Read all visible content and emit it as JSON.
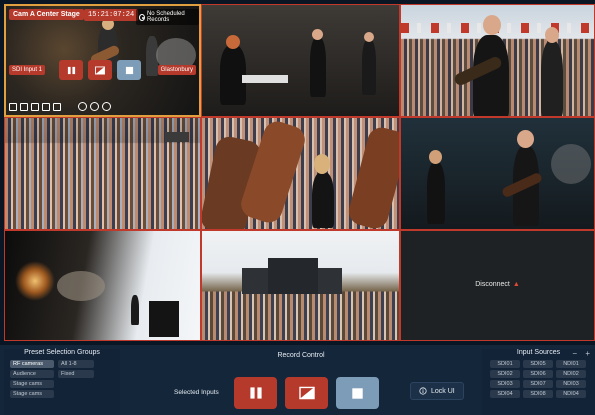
{
  "active_tile": {
    "title": "Cam A Center Stage",
    "timecode": "15:21:07:24",
    "record_status": "No Scheduled Records",
    "source": "SDI Input 1",
    "location": "Glastonbury"
  },
  "tiles": [
    {
      "name": "tile-cam-a-center-stage"
    },
    {
      "name": "tile-keyboard-stage"
    },
    {
      "name": "tile-guitarists-crowd"
    },
    {
      "name": "tile-crowd-wide"
    },
    {
      "name": "tile-guitar-closeup"
    },
    {
      "name": "tile-duo-stage"
    },
    {
      "name": "tile-drums-silhouette"
    },
    {
      "name": "tile-festival-wide"
    },
    {
      "name": "tile-disconnected"
    }
  ],
  "disconnect": {
    "label": "Disconnect"
  },
  "preset_groups": {
    "title": "Preset Selection Groups",
    "items": [
      "RF cameras",
      "All 1-8",
      "Audience",
      "Fixed",
      "Stage cams",
      "Stage cams"
    ]
  },
  "record_control": {
    "title": "Record Control",
    "selected_inputs_label": "Selected Inputs",
    "lock_label": "Lock UI"
  },
  "input_sources": {
    "title": "Input Sources",
    "controls": "− +",
    "items": [
      "SDI01",
      "SDI05",
      "NDI01",
      "SDI02",
      "SDI06",
      "NDI02",
      "SDI03",
      "SDI07",
      "NDI03",
      "SDI04",
      "SDI08",
      "NDI04"
    ]
  },
  "colors": {
    "accent_red": "#b53a2c",
    "accent_blue": "#7c9cb8",
    "panel_bg": "#14263a"
  }
}
